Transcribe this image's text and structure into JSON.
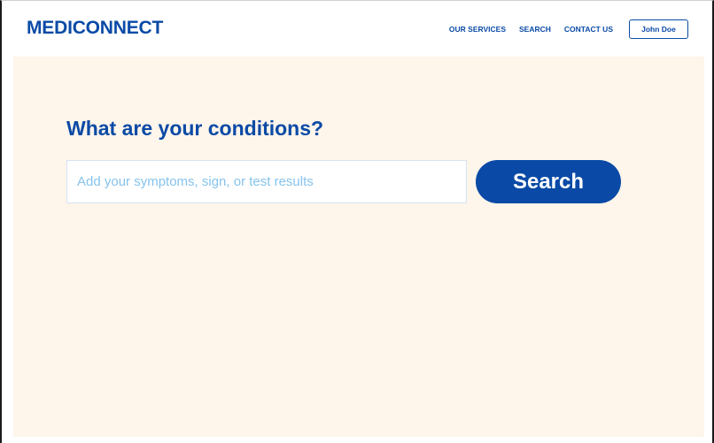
{
  "header": {
    "logo": "MEDICONNECT",
    "nav": [
      {
        "label": "OUR SERVICES"
      },
      {
        "label": "SEARCH"
      },
      {
        "label": "CONTACT US"
      }
    ],
    "user_label": "John Doe"
  },
  "main": {
    "heading": "What are your conditions?",
    "search_placeholder": "Add your symptoms, sign, or test results",
    "search_value": "",
    "search_button_label": "Search"
  },
  "colors": {
    "brand": "#0a4aa6",
    "page_background": "#fef5eb",
    "placeholder": "#86c3ec"
  }
}
